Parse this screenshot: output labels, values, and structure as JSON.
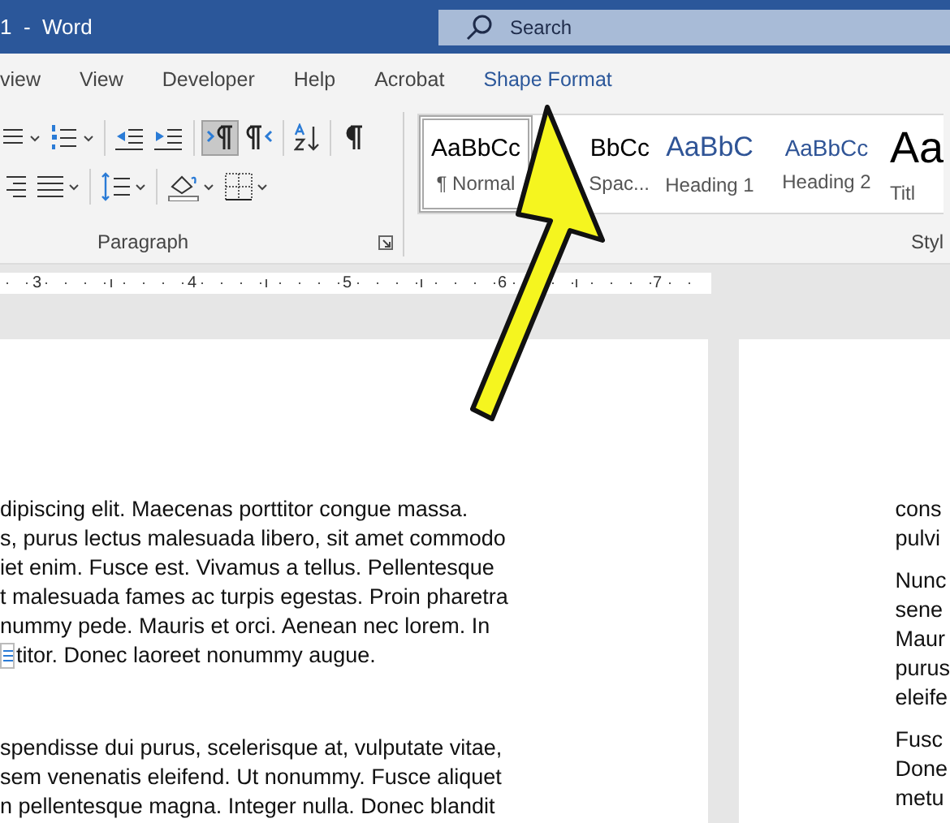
{
  "window": {
    "title": "1  -  Word",
    "search": {
      "placeholder": "Search"
    }
  },
  "tabs": [
    {
      "label": "view",
      "contextual": false
    },
    {
      "label": "View",
      "contextual": false
    },
    {
      "label": "Developer",
      "contextual": false
    },
    {
      "label": "Help",
      "contextual": false
    },
    {
      "label": "Acrobat",
      "contextual": false
    },
    {
      "label": "Shape Format",
      "contextual": true
    }
  ],
  "paragraph_group": {
    "label": "Paragraph",
    "top_buttons": [
      {
        "kind": "bullets",
        "pressed": false
      },
      {
        "kind": "numbering",
        "pressed": false
      },
      {
        "kind": "outdent",
        "pressed": false
      },
      {
        "kind": "indent",
        "pressed": false
      },
      {
        "kind": "ltr",
        "pressed": true
      },
      {
        "kind": "rtl",
        "pressed": false
      },
      {
        "kind": "sort",
        "pressed": false
      },
      {
        "kind": "pilcrow",
        "pressed": false
      }
    ],
    "bottom_buttons": [
      {
        "kind": "align-right",
        "pressed": false
      },
      {
        "kind": "justify",
        "pressed": false
      },
      {
        "kind": "spacing",
        "pressed": false
      },
      {
        "kind": "shading",
        "pressed": false
      },
      {
        "kind": "borders",
        "pressed": false
      }
    ]
  },
  "styles_group": {
    "label": "Styl",
    "styles": [
      {
        "sample": "AaBbCc",
        "name": "¶ Normal",
        "kind": "body",
        "selected": true
      },
      {
        "sample": "BbCc",
        "name": "Spac...",
        "kind": "body",
        "selected": false
      },
      {
        "sample": "AaBbC",
        "name": "Heading 1",
        "kind": "heading1",
        "selected": false
      },
      {
        "sample": "AaBbCc",
        "name": "Heading 2",
        "kind": "heading2",
        "selected": false
      },
      {
        "sample": "Aa",
        "name": "Titl",
        "kind": "title",
        "selected": false
      }
    ]
  },
  "ruler": {
    "numbers": [
      "3",
      "4",
      "5",
      "6",
      "7"
    ]
  },
  "page_1": {
    "paragraphs": [
      {
        "lines": [
          {
            "text": "dipiscing elit. Maecenas porttitor congue massa.",
            "anchor": false
          },
          {
            "text": "s, purus lectus malesuada libero, sit amet commodo",
            "anchor": false
          },
          {
            "text": "iet enim. Fusce est. Vivamus a tellus. Pellentesque",
            "anchor": false
          },
          {
            "text": "t malesuada fames ac turpis egestas. Proin pharetra",
            "anchor": false
          },
          {
            "text": "nummy pede. Mauris et orci. Aenean nec lorem. In",
            "anchor": false
          },
          {
            "text": "titor. Donec laoreet nonummy augue.",
            "anchor": true
          }
        ]
      },
      {
        "lines": [
          {
            "text": "spendisse dui purus, scelerisque at, vulputate vitae,",
            "anchor": false
          },
          {
            "text": "sem venenatis eleifend. Ut nonummy. Fusce aliquet",
            "anchor": false
          },
          {
            "text": "n pellentesque magna. Integer nulla. Donec blandit",
            "anchor": false
          }
        ]
      }
    ]
  },
  "page_2": {
    "paragraphs": [
      {
        "lines": [
          {
            "text": "cons",
            "anchor": false
          },
          {
            "text": "pulvi",
            "anchor": false
          }
        ]
      },
      {
        "lines": [
          {
            "text": "Nunc",
            "anchor": false
          },
          {
            "text": "sene",
            "anchor": false
          },
          {
            "text": "Maur",
            "anchor": false
          },
          {
            "text": "purus",
            "anchor": false
          },
          {
            "text": "eleife",
            "anchor": false
          }
        ]
      },
      {
        "lines": [
          {
            "text": "Fusc",
            "anchor": false
          },
          {
            "text": "Done",
            "anchor": false
          },
          {
            "text": "metu",
            "anchor": false
          }
        ]
      }
    ]
  }
}
